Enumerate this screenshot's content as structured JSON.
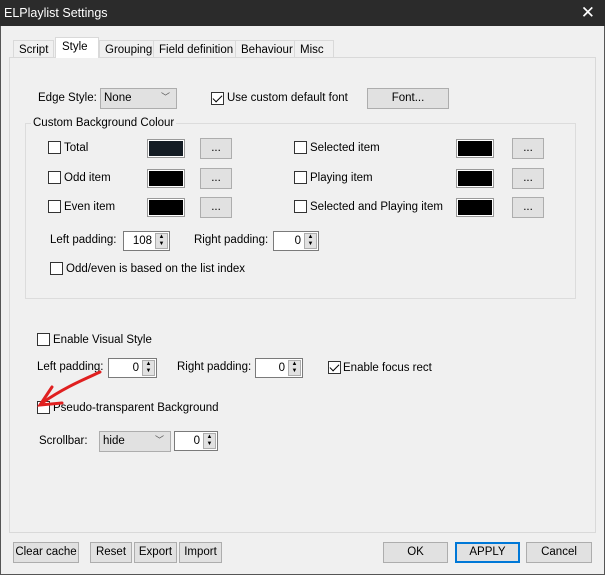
{
  "window": {
    "title": "ELPlaylist Settings",
    "close_icon": "close-icon"
  },
  "tabs": [
    {
      "label": "Script"
    },
    {
      "label": "Style",
      "active": true
    },
    {
      "label": "Grouping"
    },
    {
      "label": "Field definition"
    },
    {
      "label": "Behaviour"
    },
    {
      "label": "Misc"
    }
  ],
  "style": {
    "edge_style_label": "Edge Style:",
    "edge_style_value": "None",
    "custom_font_label": "Use custom default font",
    "custom_font_checked": true,
    "font_button": "Font...",
    "bg_group_label": "Custom Background Colour",
    "colors": [
      {
        "label": "Total",
        "checked": false,
        "color": "#141c24",
        "button": "..."
      },
      {
        "label": "Odd item",
        "checked": false,
        "color": "#000000",
        "button": "..."
      },
      {
        "label": "Even item",
        "checked": false,
        "color": "#000000",
        "button": "..."
      },
      {
        "label": "Selected item",
        "checked": false,
        "color": "#000000",
        "button": "..."
      },
      {
        "label": "Playing item",
        "checked": false,
        "color": "#000000",
        "button": "..."
      },
      {
        "label": "Selected and Playing item",
        "checked": false,
        "color": "#000000",
        "button": "..."
      }
    ],
    "group_left_padding_label": "Left padding:",
    "group_left_padding": "108",
    "group_right_padding_label": "Right padding:",
    "group_right_padding": "0",
    "odd_even_label": "Odd/even is based on the list index",
    "odd_even_checked": false,
    "visual_style_label": "Enable Visual Style",
    "visual_style_checked": false,
    "left_padding_label": "Left padding:",
    "left_padding": "0",
    "right_padding_label": "Right padding:",
    "right_padding": "0",
    "focus_rect_label": "Enable focus rect",
    "focus_rect_checked": true,
    "pseudo_label": "Pseudo-transparent Background",
    "pseudo_checked": false,
    "scrollbar_label": "Scrollbar:",
    "scrollbar_value": "hide",
    "scrollbar_num": "0",
    "annotation_color": "#e02020"
  },
  "footer": {
    "clear_cache": "Clear cache",
    "reset": "Reset",
    "export": "Export",
    "import": "Import",
    "ok": "OK",
    "apply": "APPLY",
    "cancel": "Cancel"
  }
}
